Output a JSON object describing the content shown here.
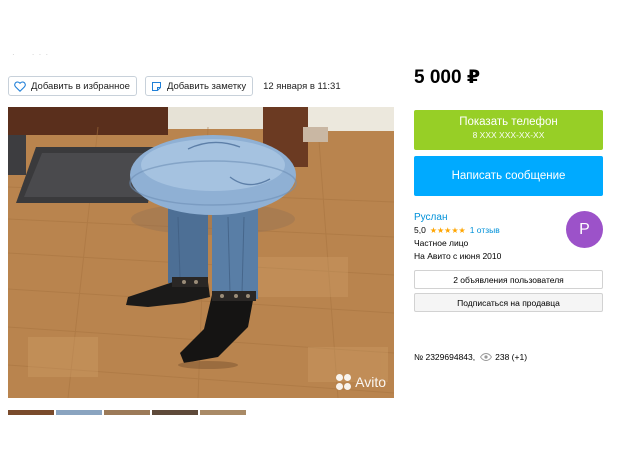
{
  "listing": {
    "favorite_label": "Добавить в избранное",
    "note_label": "Добавить заметку",
    "date": "12 января в 11:31",
    "watermark": "Avito"
  },
  "price": "5 000 ₽",
  "contact": {
    "phone_button_label": "Показать телефон",
    "phone_masked": "8 XXX XXX-XX-XX",
    "message_button_label": "Написать сообщение"
  },
  "seller": {
    "name": "Руслан",
    "rating": "5,0",
    "stars": "★★★★★",
    "rating_value": 5,
    "reviews": "1 отзыв",
    "type": "Частное лицо",
    "since": "На Авито с июня 2010",
    "avatar_letter": "Р",
    "avatar_color": "#9c52c9",
    "ads_button_label": "2 объявления пользователя",
    "subscribe_button_label": "Подписаться на продавца"
  },
  "meta": {
    "ad_number": "№ 2329694843,",
    "views": "238 (+1)"
  },
  "colors": {
    "phone_button": "#97cf26",
    "message_button": "#00aaff",
    "link": "#0091d9",
    "stars": "#ffa500"
  },
  "icons": [
    "heart-icon",
    "note-icon",
    "eye-icon",
    "avito-logo-icon"
  ]
}
